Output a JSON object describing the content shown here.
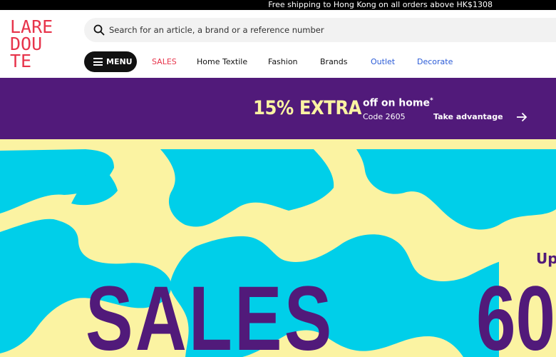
{
  "top_bar": {
    "shipping_text": "Free shipping to Hong Kong on all orders above HK$1308"
  },
  "brand": {
    "logo_lines": [
      "LARE",
      "DOU",
      "TE"
    ],
    "logo_color": "#e7344b"
  },
  "search": {
    "placeholder": "Search for an article, a brand or a reference number",
    "icon": "search-icon"
  },
  "nav": {
    "menu_label": "MENU",
    "items": [
      {
        "label": "SALES",
        "color": "#e7344b"
      },
      {
        "label": "Home Textile"
      },
      {
        "label": "Fashion"
      },
      {
        "label": "Brands"
      },
      {
        "label": "Outlet",
        "color": "#2a5bd7"
      },
      {
        "label": "Decorate",
        "color": "#2a5bd7"
      }
    ]
  },
  "promo": {
    "headline": "15% EXTRA",
    "subheadline": "off on home",
    "asterisk": "*",
    "code": "Code 2605",
    "cta": "Take advantage",
    "background": "#511a7a",
    "accent": "#fbf3a2"
  },
  "hero": {
    "title": "SALES",
    "prefix": "Up",
    "amount": "60",
    "text_color": "#511a7a",
    "pattern_colors": [
      "#00cfe9",
      "#fbf3a2"
    ]
  }
}
